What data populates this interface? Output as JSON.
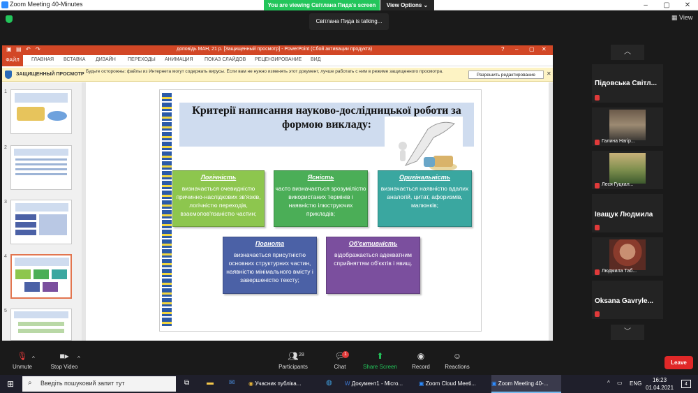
{
  "zoom": {
    "window_title": "Zoom Meeting 40-Minutes",
    "viewing_banner": "You are viewing Світлана Пида's screen",
    "view_options": "View Options",
    "talking": "Світлана Пида is talking...",
    "view_label": "View"
  },
  "ppt": {
    "title": "доповідь МАН, 21 р. [Защищенный просмотр] - PowerPoint (Сбой активации продукта)",
    "tabs": [
      "ФАЙЛ",
      "ГЛАВНАЯ",
      "ВСТАВКА",
      "ДИЗАЙН",
      "ПЕРЕХОДЫ",
      "АНИМАЦИЯ",
      "ПОКАЗ СЛАЙДОВ",
      "РЕЦЕНЗИРОВАНИЕ",
      "ВИД"
    ],
    "protected_title": "ЗАЩИЩЕННЫЙ ПРОСМОТР",
    "protected_msg": "Будьте осторожны: файлы из Интернета могут содержать вирусы. Если вам не нужно изменять этот документ, лучше работать с ним в режиме защищенного просмотра.",
    "edit_button": "Разрешить редактирование",
    "thumb_numbers": [
      "1",
      "2",
      "3",
      "4",
      "5"
    ]
  },
  "slide": {
    "title": "Критерії написання науково-дослідницької роботи за формою викладу:",
    "boxes": [
      {
        "heading": "Логічність",
        "text": "визначається очевидністю причинно-наслідкових зв'язків, логічністю переходів, взаємопов'язаністю частин;",
        "color": "#8dc64e"
      },
      {
        "heading": "Ясність",
        "text": "часто визначається зрозумілістю використаних термінів і наявністю ілюструючих прикладів;",
        "color": "#4bae57"
      },
      {
        "heading": "Оригінальність",
        "text": "визначається наявністю вдалих аналогій, цитат, афоризмів, малюнків;",
        "color": "#3aa7a0"
      },
      {
        "heading": "Повнота",
        "text": "визначається присутністю основних структурних частин, наявністю мінімального вмісту і завершеністю тексту;",
        "color": "#4b61a6"
      },
      {
        "heading": "Об'єктивність",
        "text": "відображається адекватним сприйняттям об'єктів і явищ.",
        "color": "#7b4f9e"
      }
    ]
  },
  "participants": [
    {
      "name": "Підовська Світл..."
    },
    {
      "name": "Галина Нагір..."
    },
    {
      "name": "Леся Гуцкал..."
    },
    {
      "name": "Іващук Людмила"
    },
    {
      "name": "Людмила Таб..."
    },
    {
      "name": "Oksana Gavryle..."
    }
  ],
  "controls": {
    "unmute": "Unmute",
    "stop_video": "Stop Video",
    "participants": "Participants",
    "participants_count": "28",
    "chat": "Chat",
    "chat_badge": "1",
    "share": "Share Screen",
    "record": "Record",
    "reactions": "Reactions",
    "leave": "Leave"
  },
  "taskbar": {
    "search": "Введіть пошуковий запит тут",
    "apps": [
      "Учасник публіка...",
      "Документ1 - Micro...",
      "Zoom Cloud Meeti...",
      "Zoom Meeting 40-..."
    ],
    "lang": "ENG",
    "time": "16:23",
    "date": "01.04.2021",
    "notif": "4"
  }
}
